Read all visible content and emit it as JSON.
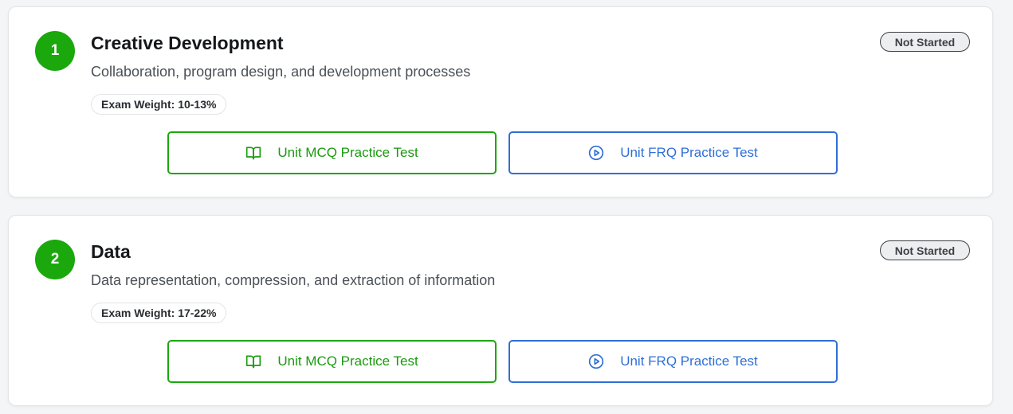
{
  "units": [
    {
      "number": "1",
      "title": "Creative Development",
      "description": "Collaboration, program design, and development processes",
      "exam_weight": "Exam Weight: 10-13%",
      "status": "Not Started",
      "mcq_label": "Unit MCQ Practice Test",
      "frq_label": "Unit FRQ Practice Test"
    },
    {
      "number": "2",
      "title": "Data",
      "description": "Data representation, compression, and extraction of information",
      "exam_weight": "Exam Weight: 17-22%",
      "status": "Not Started",
      "mcq_label": "Unit MCQ Practice Test",
      "frq_label": "Unit FRQ Practice Test"
    }
  ],
  "icons": {
    "mcq": "book-open-icon",
    "frq": "play-circle-icon"
  },
  "colors": {
    "accent_green": "#1aa80c",
    "accent_blue": "#2f6fd6"
  }
}
